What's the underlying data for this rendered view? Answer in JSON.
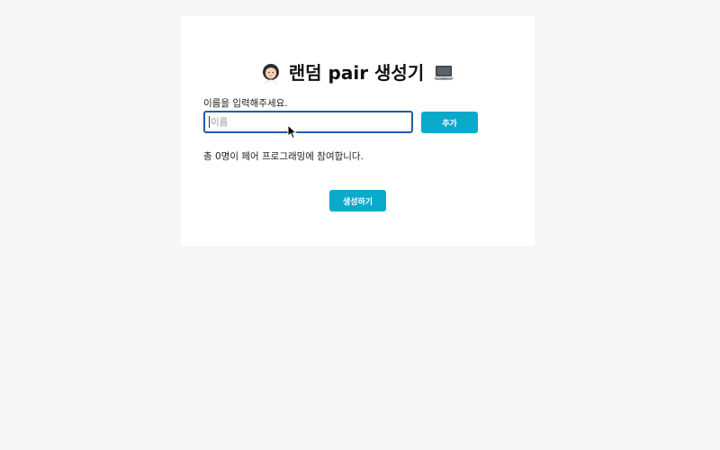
{
  "app": {
    "title": "랜덤 pair 생성기",
    "title_icon_left": "woman-technologist-emoji",
    "title_icon_right": "laptop-emoji"
  },
  "form": {
    "label": "이름을 입력해주세요.",
    "input_value": "",
    "input_placeholder": "이름",
    "add_button_label": "추가"
  },
  "summary": {
    "text": "총 0명이 페어 프로그래밍에 참여합니다."
  },
  "actions": {
    "generate_button_label": "생성하기"
  },
  "colors": {
    "accent": "#0aaacb",
    "input_focus_border": "#1f5fa6",
    "page_background": "#f7f7f8",
    "card_background": "#ffffff"
  }
}
